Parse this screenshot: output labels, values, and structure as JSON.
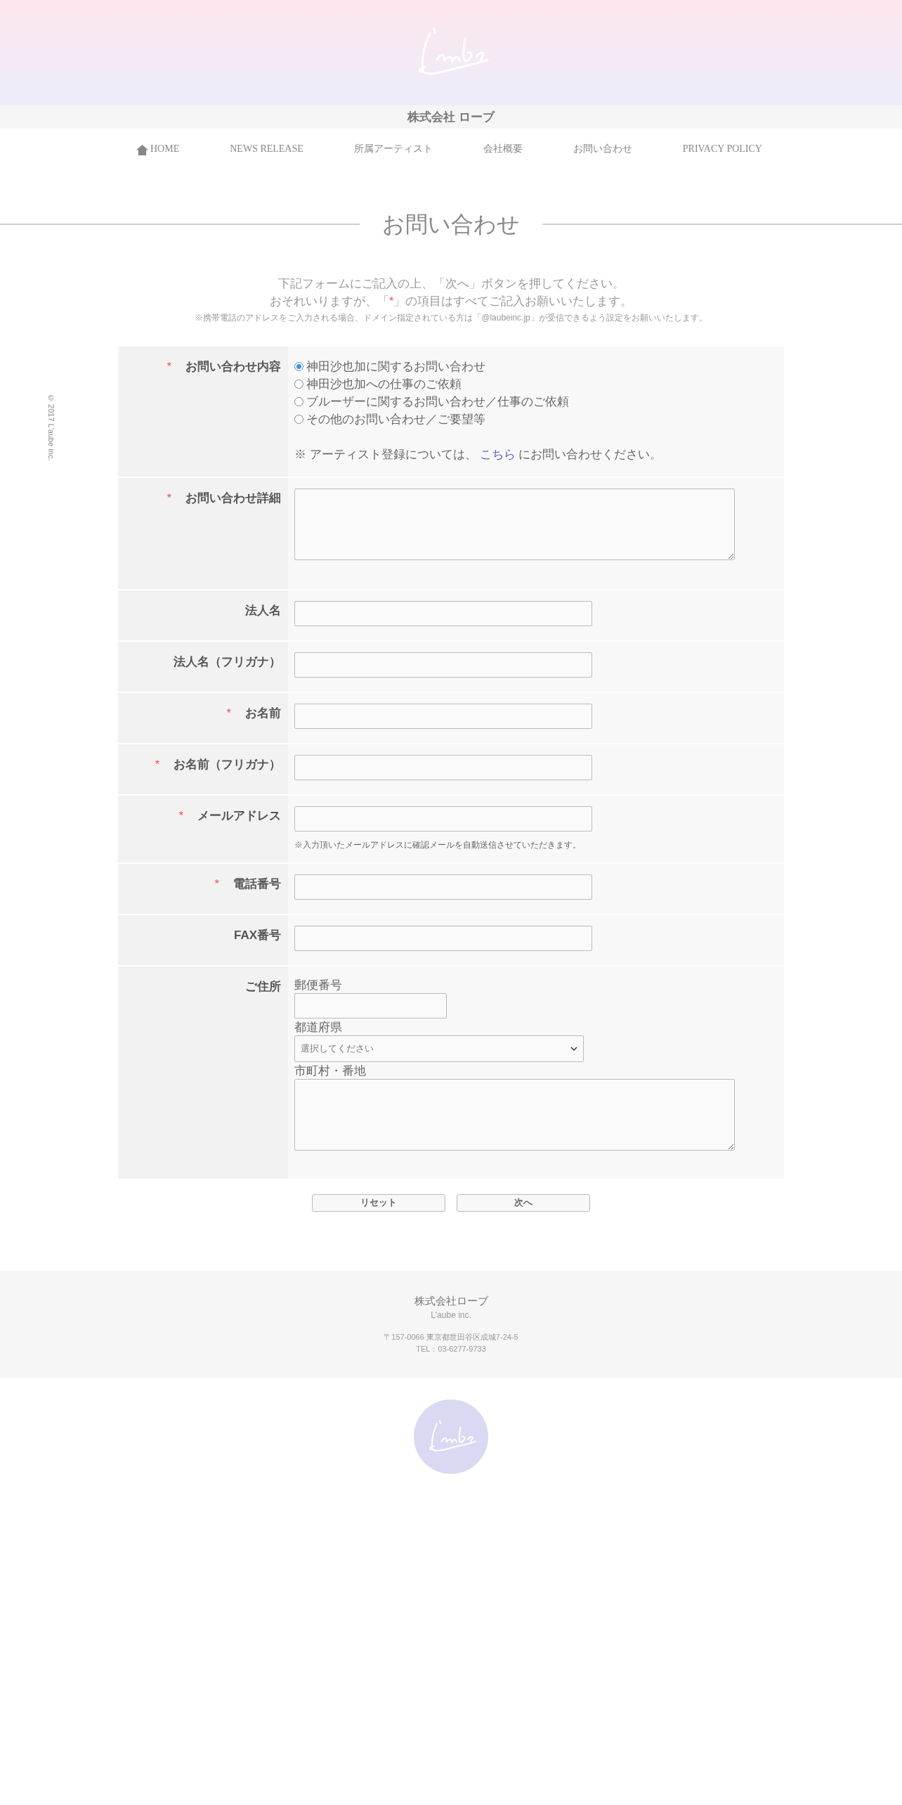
{
  "header": {
    "company_name": "株式会社 ローブ"
  },
  "nav": [
    {
      "label": "HOME",
      "kind": "home"
    },
    {
      "label": "NEWS RELEASE",
      "kind": "text"
    },
    {
      "label": "所属アーティスト",
      "kind": "text"
    },
    {
      "label": "会社概要",
      "kind": "text"
    },
    {
      "label": "お問い合わせ",
      "kind": "text"
    },
    {
      "label": "PRIVACY POLICY",
      "kind": "text"
    }
  ],
  "page_title": "お問い合わせ",
  "intro": {
    "line1": "下記フォームにご記入の上、「次へ」ボタンを押してください。",
    "line2_before": "おそれいりますが、「",
    "line2_mark": "*",
    "line2_after": "」の項目はすべてご記入お願いいたします。",
    "note": "※携帯電話のアドレスをご入力される場合、ドメイン指定されている方は「@laubeinc.jp」が受信できるよう設定をお願いいたします。"
  },
  "copyright": "© 2017 L'aube inc.",
  "form": {
    "rows": [
      {
        "label": "お問い合わせ内容",
        "required": true,
        "kind": "radio",
        "options": [
          {
            "label": "神田沙也加に関するお問い合わせ",
            "selected": true
          },
          {
            "label": "神田沙也加への仕事のご依頼",
            "selected": false
          },
          {
            "label": "ブルーザーに関するお問い合わせ／仕事のご依頼",
            "selected": false
          },
          {
            "label": "その他のお問い合わせ／ご要望等",
            "selected": false
          }
        ],
        "note": {
          "before": "※ アーティスト登録については、",
          "link": "こちら",
          "after": "にお問い合わせください。"
        }
      },
      {
        "label": "お問い合わせ詳細",
        "required": true,
        "kind": "textarea"
      },
      {
        "label": "法人名",
        "required": false,
        "kind": "text"
      },
      {
        "label": "法人名（フリガナ）",
        "required": false,
        "kind": "text"
      },
      {
        "label": "お名前",
        "required": true,
        "kind": "text"
      },
      {
        "label": "お名前（フリガナ）",
        "required": true,
        "kind": "text"
      },
      {
        "label": "メールアドレス",
        "required": true,
        "kind": "text",
        "hint": "※入力頂いたメールアドレスに確認メールを自動送信させていただきます。"
      },
      {
        "label": "電話番号",
        "required": true,
        "kind": "text"
      },
      {
        "label": "FAX番号",
        "required": false,
        "kind": "text"
      },
      {
        "label": "ご住所",
        "required": false,
        "kind": "address",
        "fields": [
          {
            "label": "郵便番号",
            "kind": "short"
          },
          {
            "label": "都道府県",
            "kind": "select",
            "value": "選択してください"
          },
          {
            "label": "市町村・番地",
            "kind": "textarea"
          }
        ]
      }
    ]
  },
  "buttons": [
    {
      "label": "リセット"
    },
    {
      "label": "次へ"
    }
  ],
  "footer": {
    "company": "株式会社ローブ",
    "company_en": "L'aube inc.",
    "address": "〒157-0066 東京都世田谷区成城7-24-5",
    "tel": "TEL：03-6277-9733"
  }
}
